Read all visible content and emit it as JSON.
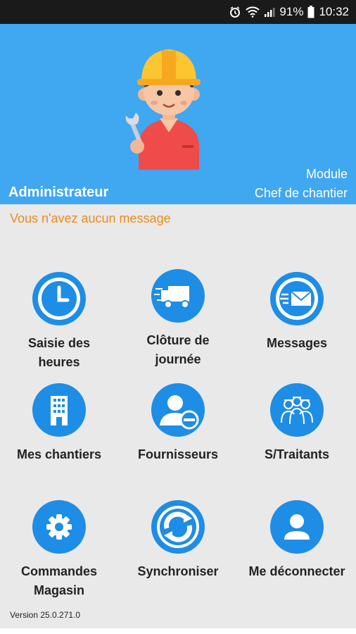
{
  "statusbar": {
    "battery": "91%",
    "time": "10:32"
  },
  "header": {
    "user": "Administrateur",
    "module_line1": "Module",
    "module_line2": "Chef de chantier"
  },
  "message": "Vous n'avez aucun message",
  "menu": [
    {
      "line1": "Saisie des",
      "line2": "heures",
      "icon": "clock-icon"
    },
    {
      "line1": "Clôture de",
      "line2": "journée",
      "icon": "truck-icon"
    },
    {
      "line1": "Messages",
      "line2": "",
      "icon": "envelope-icon"
    },
    {
      "line1": "Mes chantiers",
      "line2": "",
      "icon": "building-icon"
    },
    {
      "line1": "Fournisseurs",
      "line2": "",
      "icon": "supplier-icon"
    },
    {
      "line1": "S/Traitants",
      "line2": "",
      "icon": "workers-icon"
    },
    {
      "line1": "Commandes",
      "line2": "Magasin",
      "icon": "gear-icon"
    },
    {
      "line1": "Synchroniser",
      "line2": "",
      "icon": "sync-icon"
    },
    {
      "line1": "Me déconnecter",
      "line2": "",
      "icon": "user-icon"
    }
  ],
  "version": "Version 25.0.271.0",
  "colors": {
    "header": "#40a7f1",
    "accent": "#1e8de6",
    "message": "#ef8a19"
  }
}
